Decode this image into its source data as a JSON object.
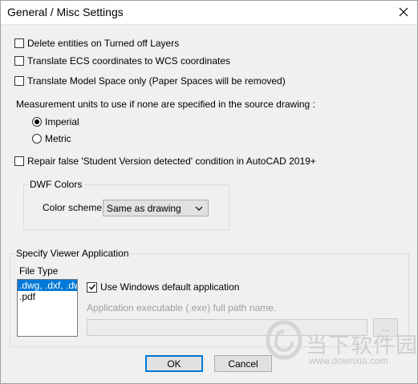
{
  "window": {
    "title": "General / Misc Settings",
    "accent": "#0078d7"
  },
  "options": {
    "delete_entities": {
      "label": "Delete entities on Turned off Layers",
      "checked": false
    },
    "translate_ecs": {
      "label": "Translate ECS coordinates to WCS coordinates",
      "checked": false
    },
    "translate_model": {
      "label": "Translate Model Space only (Paper Spaces will be removed)",
      "checked": false
    }
  },
  "units": {
    "label": "Measurement units to use if none are specified in the source drawing :",
    "imperial": {
      "label": "Imperial",
      "selected": true
    },
    "metric": {
      "label": "Metric",
      "selected": false
    }
  },
  "repair": {
    "label": "Repair false 'Student Version detected' condition in AutoCAD 2019+",
    "checked": false
  },
  "dwf": {
    "legend": "DWF Colors",
    "scheme_label": "Color scheme:",
    "scheme_value": "Same as drawing"
  },
  "viewer": {
    "legend": "Specify Viewer Application",
    "file_type_label": "File Type",
    "file_types": [
      ".dwg, .dxf, .dwf",
      ".pdf"
    ],
    "use_default": {
      "label": "Use Windows default application",
      "checked": true
    },
    "exe_label": "Application executable (.exe) full path name.",
    "exe_value": "",
    "browse_label": "..."
  },
  "buttons": {
    "ok": "OK",
    "cancel": "Cancel"
  },
  "watermark": {
    "brand_cn": "当下软件园",
    "url": "www.downxia.com"
  }
}
